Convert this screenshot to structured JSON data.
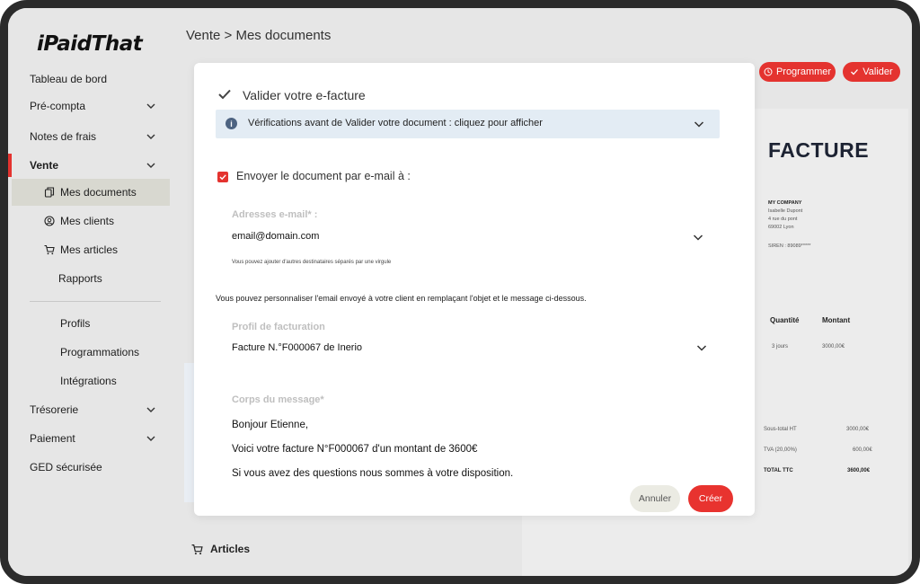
{
  "app": {
    "logo": "iPaidThat"
  },
  "breadcrumb": "Vente > Mes documents",
  "sidebar": {
    "items": [
      {
        "label": "Tableau de bord"
      },
      {
        "label": "Pré-compta"
      },
      {
        "label": "Notes de frais"
      },
      {
        "label": "Vente"
      },
      {
        "label": "Trésorerie"
      },
      {
        "label": "Paiement"
      },
      {
        "label": "GED sécurisée"
      }
    ],
    "sub_items": [
      {
        "label": "Mes documents",
        "icon": "documents-icon"
      },
      {
        "label": "Mes clients",
        "icon": "user-circle-icon"
      },
      {
        "label": "Mes articles",
        "icon": "cart-icon"
      },
      {
        "label": "Rapports"
      }
    ],
    "extra_items": [
      {
        "label": "Profils"
      },
      {
        "label": "Programmations"
      },
      {
        "label": "Intégrations"
      }
    ]
  },
  "toolbar": {
    "programmer_label": "Programmer",
    "valider_label": "Valider"
  },
  "invoice": {
    "title": "FACTURE",
    "company": [
      "MY COMPANY",
      "Isabelle Dupont",
      "4 rue du pont",
      "69002 Lyon"
    ],
    "siren": "SIREN : 89089*****",
    "col_qty": "Quantité",
    "col_amount": "Montant",
    "row_qty": "3 jours",
    "row_amount": "3000,00€",
    "subtotal_label": "Sous-total HT",
    "subtotal_value": "3000,00€",
    "tva_label": "TVA (20,00%)",
    "tva_value": "600,00€",
    "total_label": "TOTAL TTC",
    "total_value": "3600,00€"
  },
  "articles_label": "Articles",
  "modal": {
    "title": "Valider votre e-facture",
    "info_text": "Vérifications avant de Valider votre document : cliquez pour afficher",
    "send_email_label": "Envoyer le document par e-mail à :",
    "email_label": "Adresses e-mail* :",
    "email_value": "email@domain.com",
    "email_hint": "Vous pouvez ajouter d'autres destinataires séparés par une virgule",
    "custom_note": "Vous pouvez personnaliser l'email envoyé à votre client en remplaçant l'objet et le message ci-dessous.",
    "profile_label": "Profil de facturation",
    "profile_value": "Facture N.°F000067 de Inerio",
    "body_label": "Corps du message*",
    "body_lines": [
      "Bonjour Etienne,",
      "Voici votre facture N°F000067 d'un montant de 3600€",
      "Si vous avez des questions nous sommes à votre disposition."
    ],
    "cancel_label": "Annuler",
    "create_label": "Créer"
  },
  "colors": {
    "accent": "#e4332f",
    "info_bg": "#e3ecf4",
    "sidebar_bg": "#e6e6e6"
  }
}
